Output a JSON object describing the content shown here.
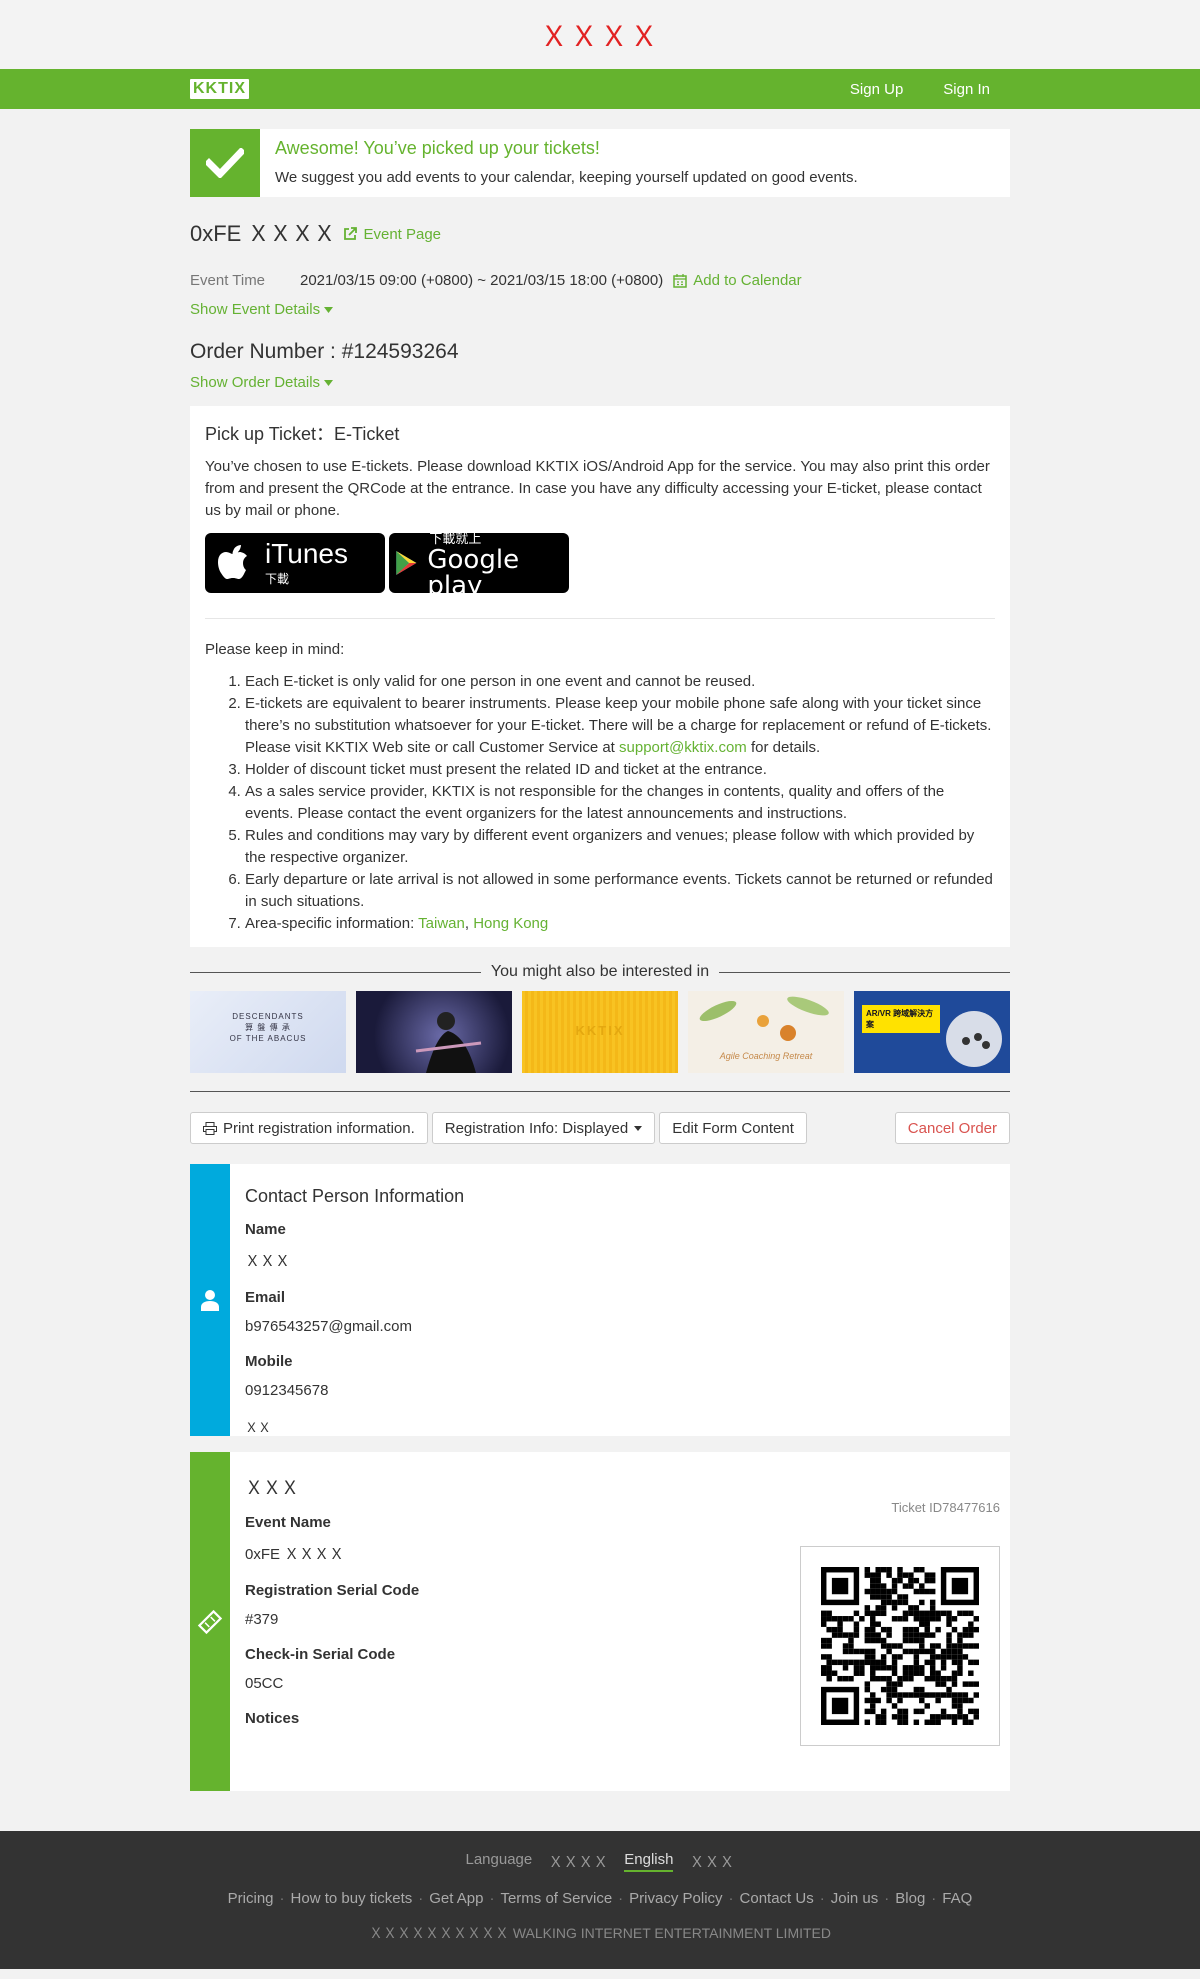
{
  "top_banner": "ＸＸＸＸ",
  "nav": {
    "logo": "KKTIX",
    "signup": "Sign Up",
    "signin": "Sign In"
  },
  "alert": {
    "title": "Awesome! You’ve picked up your tickets!",
    "message": "We suggest you add events to your calendar, keeping yourself updated on good events."
  },
  "event": {
    "name": "0xFE ＸＸＸＸ",
    "page_link": "Event Page",
    "time_label": "Event Time",
    "time_value": "2021/03/15 09:00 (+0800) ~ 2021/03/15 18:00 (+0800)",
    "add_calendar": "Add to Calendar",
    "show_details": "Show Event Details"
  },
  "order": {
    "number": "Order Number : #124593264",
    "show_details": "Show Order Details"
  },
  "pickup": {
    "title": "Pick up Ticket：E-Ticket",
    "description": "You’ve chosen to use E-tickets. Please download KKTIX iOS/Android App for the service. You may also print this order from and present the QRCode at the entrance. In case you have any difficulty accessing your E-ticket, please contact us by mail or phone.",
    "itunes_big": "iTunes",
    "itunes_small": "下載",
    "gplay_small": "下載就上",
    "gplay_big": "Google play",
    "keep_in_mind": "Please keep in mind:",
    "rules": [
      "Each E-ticket is only valid for one person in one event and cannot be reused.",
      "E-tickets are equivalent to bearer instruments. Please keep your mobile phone safe along with your ticket since there’s no substitution whatsoever for your E-ticket. There will be a charge for replacement or refund of E-tickets. Please visit KKTIX Web site or call Customer Service at ",
      "Holder of discount ticket must present the related ID and ticket at the entrance.",
      "As a sales service provider, KKTIX is not responsible for the changes in contents, quality and offers of the events. Please contact the event organizers for the latest announcements and instructions.",
      "Rules and conditions may vary by different event organizers and venues; please follow with which provided by the respective organizer.",
      "Early departure or late arrival is not allowed in some performance events. Tickets cannot be returned or refunded in such situations.",
      "Area-specific information: "
    ],
    "support_email": "support@kktix.com",
    "rule2_suffix": " for details.",
    "area_taiwan": "Taiwan",
    "area_hk": "Hong Kong",
    "area_sep": ", "
  },
  "interest": {
    "title": "You might also be interested in",
    "thumb1_text": "DESCENDANTS\n算 盤 傳 承\nOF THE ABACUS",
    "thumb3_text": "KKTIX",
    "thumb4_text": "Agile Coaching Retreat",
    "thumb5_text": "AR/VR 跨域解決方案"
  },
  "actions": {
    "print": "Print registration information.",
    "reg_info": "Registration Info: Displayed",
    "edit": "Edit Form Content",
    "cancel": "Cancel Order"
  },
  "contact": {
    "title": "Contact Person Information",
    "name_label": "Name",
    "name_value": "ＸＸＸ",
    "email_label": "Email",
    "email_value": "b976543257@gmail.com",
    "mobile_label": "Mobile",
    "mobile_value": "0912345678",
    "extra": "ＸＸ"
  },
  "ticket": {
    "title": "ＸＸＸ",
    "ticket_id": "Ticket ID78477616",
    "event_name_label": "Event Name",
    "event_name_value": "0xFE ＸＸＸＸ",
    "reg_serial_label": "Registration Serial Code",
    "reg_serial_value": "#379",
    "checkin_label": "Check-in Serial Code",
    "checkin_value": "05CC",
    "notices_label": "Notices"
  },
  "footer": {
    "language_label": "Language",
    "lang_zh": "ＸＸＸＸ",
    "lang_en": "English",
    "lang_jp": "ＸＸＸ",
    "links": [
      "Pricing",
      "How to buy tickets",
      "Get App",
      "Terms of Service",
      "Privacy Policy",
      "Contact Us",
      "Join us",
      "Blog",
      "FAQ"
    ],
    "copyright": "ＸＸＸＸＸＸＸＸＸＸ WALKING INTERNET ENTERTAINMENT LIMITED"
  },
  "colors": {
    "brand_green": "#65b32e",
    "contact_blue": "#00aadd",
    "cancel_red": "#d9534f",
    "banner_red": "#e22222"
  }
}
